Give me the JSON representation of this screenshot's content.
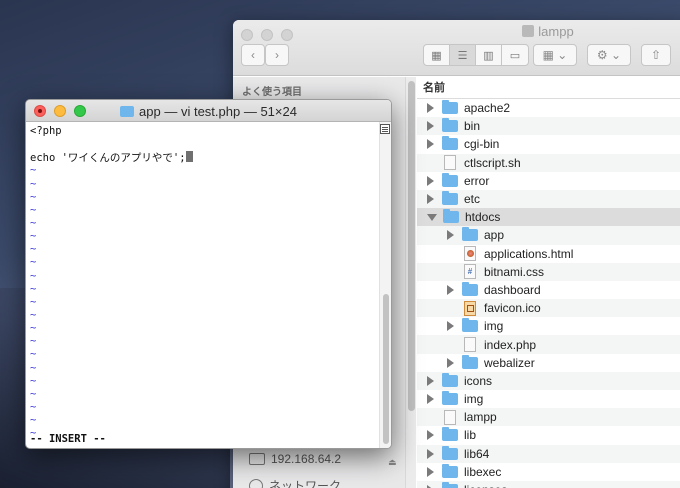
{
  "finder": {
    "title": "lampp",
    "sidebar_heading": "よく使う項目",
    "sidebar_items": [
      {
        "label": "192.168.64.2",
        "icon": "monitor-icon"
      },
      {
        "label": "ネットワーク",
        "icon": "network-icon"
      }
    ],
    "column_header": "名前",
    "rows": [
      {
        "name": "apache2",
        "kind": "folder",
        "disclosure": "right",
        "depth": 0
      },
      {
        "name": "bin",
        "kind": "folder",
        "disclosure": "right",
        "depth": 0
      },
      {
        "name": "cgi-bin",
        "kind": "folder",
        "disclosure": "right",
        "depth": 0
      },
      {
        "name": "ctlscript.sh",
        "kind": "file",
        "disclosure": "none",
        "depth": 0
      },
      {
        "name": "error",
        "kind": "folder",
        "disclosure": "right",
        "depth": 0
      },
      {
        "name": "etc",
        "kind": "folder",
        "disclosure": "right",
        "depth": 0
      },
      {
        "name": "htdocs",
        "kind": "folder",
        "disclosure": "down",
        "depth": 0,
        "selected": true
      },
      {
        "name": "app",
        "kind": "folder",
        "disclosure": "right",
        "depth": 1
      },
      {
        "name": "applications.html",
        "kind": "html",
        "disclosure": "none",
        "depth": 1
      },
      {
        "name": "bitnami.css",
        "kind": "css",
        "disclosure": "none",
        "depth": 1
      },
      {
        "name": "dashboard",
        "kind": "folder",
        "disclosure": "right",
        "depth": 1
      },
      {
        "name": "favicon.ico",
        "kind": "ico",
        "disclosure": "none",
        "depth": 1
      },
      {
        "name": "img",
        "kind": "folder",
        "disclosure": "right",
        "depth": 1
      },
      {
        "name": "index.php",
        "kind": "file",
        "disclosure": "none",
        "depth": 1
      },
      {
        "name": "webalizer",
        "kind": "folder",
        "disclosure": "right",
        "depth": 1
      },
      {
        "name": "icons",
        "kind": "folder",
        "disclosure": "right",
        "depth": 0
      },
      {
        "name": "img",
        "kind": "folder",
        "disclosure": "right",
        "depth": 0
      },
      {
        "name": "lampp",
        "kind": "file",
        "disclosure": "none",
        "depth": 0
      },
      {
        "name": "lib",
        "kind": "folder",
        "disclosure": "right",
        "depth": 0
      },
      {
        "name": "lib64",
        "kind": "folder",
        "disclosure": "right",
        "depth": 0
      },
      {
        "name": "libexec",
        "kind": "folder",
        "disclosure": "right",
        "depth": 0
      },
      {
        "name": "licenses",
        "kind": "folder",
        "disclosure": "right",
        "depth": 0
      }
    ]
  },
  "terminal": {
    "title": "app — vi test.php — 51×24",
    "lines": [
      "<?php",
      "",
      "echo 'ワイくんのアプリやで';"
    ],
    "tilde": "~",
    "tilde_count": 21,
    "status": "-- INSERT --"
  }
}
